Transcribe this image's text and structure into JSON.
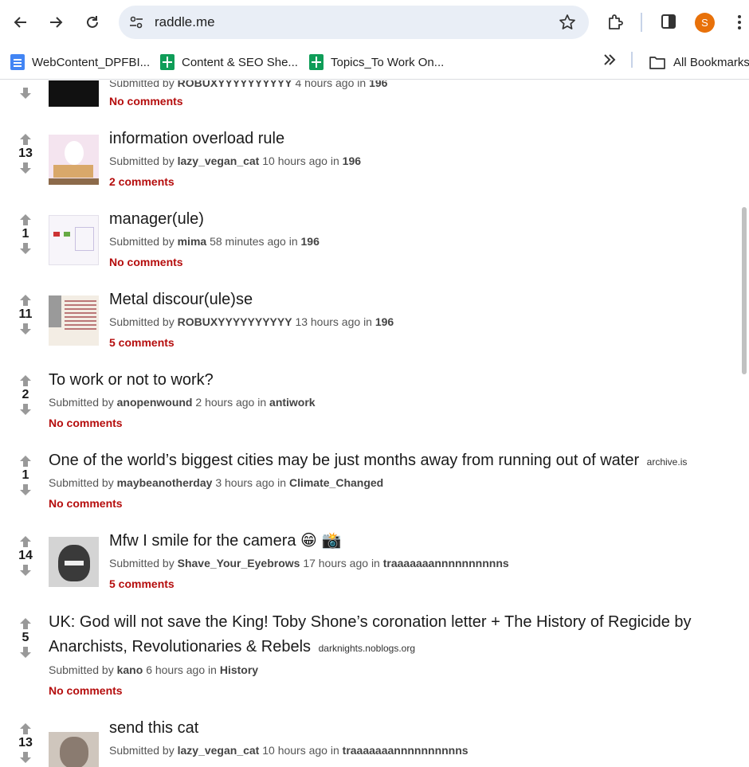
{
  "browser": {
    "url": "raddle.me",
    "avatar_letter": "S",
    "bookmarks": [
      {
        "label": "WebContent_DPFBI...",
        "icon": "docs-icon"
      },
      {
        "label": "Content & SEO She...",
        "icon": "sheets-icon"
      },
      {
        "label": "Topics_To Work On...",
        "icon": "sheets-icon"
      }
    ],
    "all_bookmarks": "All Bookmarks"
  },
  "labels": {
    "submitted_by": "Submitted by",
    "in": "in"
  },
  "posts": [
    {
      "score": "",
      "title": "",
      "domain": "",
      "author": "ROBUXYYYYYYYYYY",
      "time": "4 hours ago",
      "forum": "196",
      "comments": "No comments"
    },
    {
      "score": "13",
      "title": "information overload rule",
      "domain": "",
      "author": "lazy_vegan_cat",
      "time": "10 hours ago",
      "forum": "196",
      "comments": "2 comments"
    },
    {
      "score": "1",
      "title": "manager(ule)",
      "domain": "",
      "author": "mima",
      "time": "58 minutes ago",
      "forum": "196",
      "comments": "No comments"
    },
    {
      "score": "11",
      "title": "Metal discour(ule)se",
      "domain": "",
      "author": "ROBUXYYYYYYYYYY",
      "time": "13 hours ago",
      "forum": "196",
      "comments": "5 comments"
    },
    {
      "score": "2",
      "title": "To work or not to work?",
      "domain": "",
      "author": "anopenwound",
      "time": "2 hours ago",
      "forum": "antiwork",
      "comments": "No comments"
    },
    {
      "score": "1",
      "title": "One of the world’s biggest cities may be just months away from running out of water",
      "domain": "archive.is",
      "author": "maybeanotherday",
      "time": "3 hours ago",
      "forum": "Climate_Changed",
      "comments": "No comments"
    },
    {
      "score": "14",
      "title": "Mfw I smile for the camera 😁 📸",
      "domain": "",
      "author": "Shave_Your_Eyebrows",
      "time": "17 hours ago",
      "forum": "traaaaaaannnnnnnnnns",
      "comments": "5 comments"
    },
    {
      "score": "5",
      "title": "UK: God will not save the King! Toby Shone’s coronation letter + The History of Regicide by Anarchists, Revolutionaries & Rebels",
      "domain": "darknights.noblogs.org",
      "author": "kano",
      "time": "6 hours ago",
      "forum": "History",
      "comments": "No comments"
    },
    {
      "score": "13",
      "title": "send this cat",
      "domain": "",
      "author": "lazy_vegan_cat",
      "time": "10 hours ago",
      "forum": "traaaaaaannnnnnnnnns",
      "comments": ""
    }
  ],
  "colors": {
    "comments_link": "#b50d0d",
    "avatar": "#e8710a",
    "omnibox": "#e9eef6"
  }
}
